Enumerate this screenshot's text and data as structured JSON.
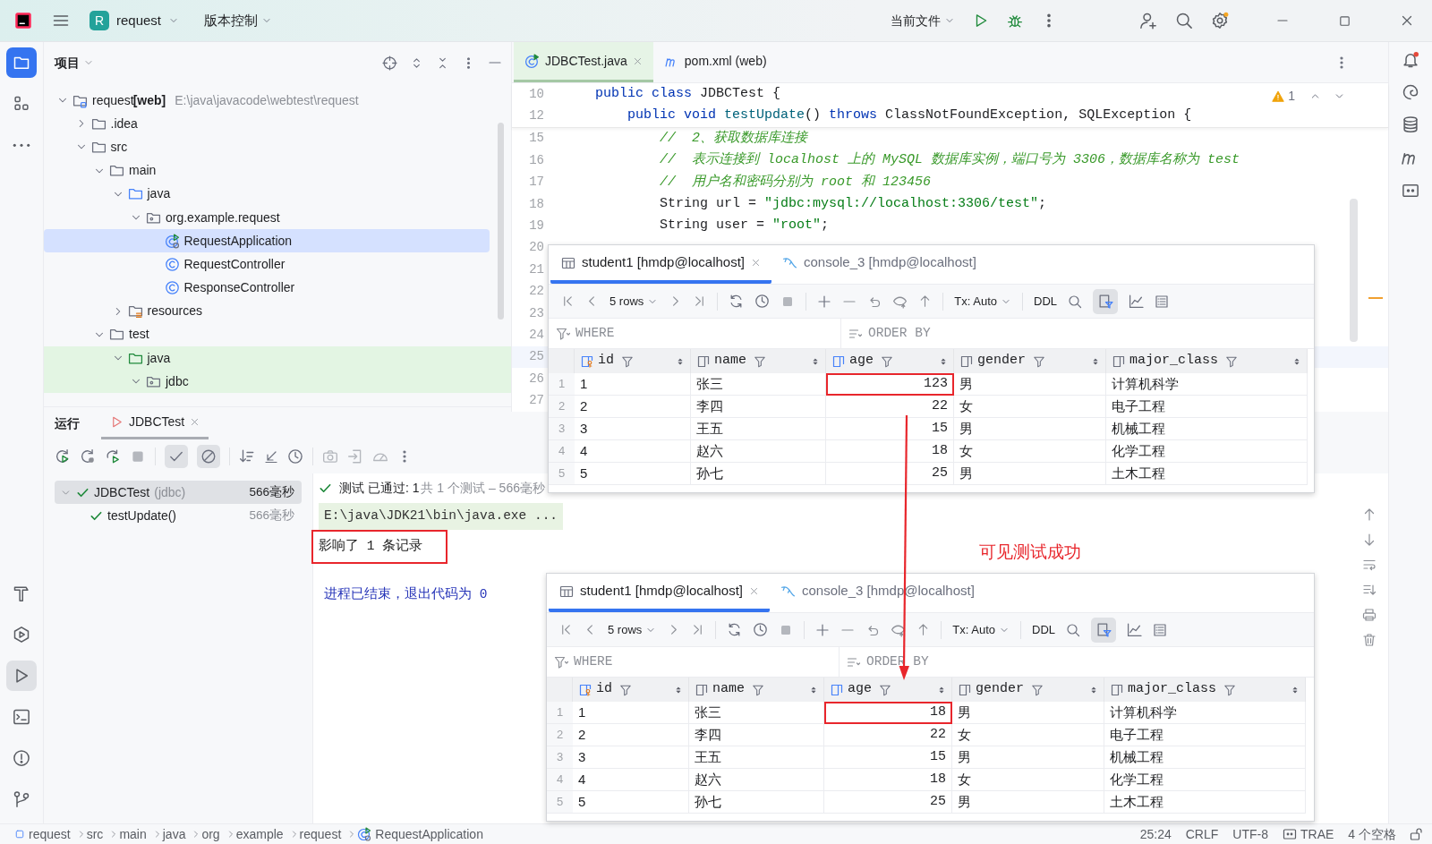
{
  "title_bar": {
    "project_badge": "R",
    "project": "request",
    "vcs": "版本控制",
    "run_config": "当前文件"
  },
  "left_tools": [
    {
      "kind": "project",
      "selected": true
    },
    {
      "kind": "structure",
      "selected": false
    },
    {
      "kind": "more",
      "selected": false
    },
    {
      "kind": "build",
      "selected": false
    },
    {
      "kind": "services",
      "selected": false
    },
    {
      "kind": "run",
      "selected": true
    },
    {
      "kind": "terminal",
      "selected": false
    },
    {
      "kind": "problems",
      "selected": false
    },
    {
      "kind": "git",
      "selected": false
    }
  ],
  "project_panel": {
    "title": "项目",
    "tree": [
      {
        "label": "request",
        "tag": "[web]",
        "path": "E:\\java\\javacode\\webtest\\request",
        "kind": "module",
        "expanded": true,
        "selected": false,
        "children": [
          {
            "label": ".idea",
            "kind": "folder",
            "expanded": false,
            "selected": false
          },
          {
            "label": "src",
            "kind": "folder",
            "expanded": true,
            "selected": false,
            "children": [
              {
                "label": "main",
                "kind": "folder",
                "expanded": true,
                "selected": false,
                "children": [
                  {
                    "label": "java",
                    "kind": "source",
                    "expanded": true,
                    "selected": false,
                    "children": [
                      {
                        "label": "org.example.request",
                        "kind": "package",
                        "expanded": true,
                        "selected": false,
                        "children": [
                          {
                            "label": "RequestApplication",
                            "kind": "app",
                            "selected": true
                          },
                          {
                            "label": "RequestController",
                            "kind": "class",
                            "selected": false
                          },
                          {
                            "label": "ResponseController",
                            "kind": "class",
                            "selected": false
                          }
                        ]
                      }
                    ]
                  },
                  {
                    "label": "resources",
                    "kind": "resources",
                    "expanded": false,
                    "selected": false
                  }
                ]
              },
              {
                "label": "test",
                "kind": "folder",
                "expanded": true,
                "selected": false,
                "children": [
                  {
                    "label": "java",
                    "kind": "test-source",
                    "expanded": true,
                    "selected": false,
                    "children": [
                      {
                        "label": "jdbc",
                        "kind": "package",
                        "expanded": true,
                        "selected": false
                      }
                    ]
                  }
                ]
              }
            ]
          }
        ]
      }
    ]
  },
  "editor": {
    "tabs": [
      {
        "label": "JDBCTest.java",
        "kind": "test-class",
        "selected": true,
        "closable": true
      },
      {
        "label": "pom.xml (web)",
        "kind": "maven",
        "selected": false,
        "closable": false
      }
    ],
    "warnings": "1",
    "sticky_lines": [
      {
        "number": "10",
        "tokens": [
          {
            "kind": "keyword",
            "text": "public class"
          },
          {
            "kind": "plain",
            "text": " JDBCTest {"
          }
        ]
      },
      {
        "number": "12",
        "tokens": [
          {
            "kind": "keyword",
            "text": "    public void"
          },
          {
            "kind": "method",
            "text": " testUpdate"
          },
          {
            "kind": "plain",
            "text": "() "
          },
          {
            "kind": "keyword",
            "text": "throws"
          },
          {
            "kind": "plain",
            "text": " ClassNotFoundException, SQLException {"
          }
        ]
      }
    ],
    "lines": [
      {
        "number": "15",
        "current": false,
        "tokens": [
          {
            "kind": "comment",
            "text": "        //  2、获取数据库连接"
          }
        ]
      },
      {
        "number": "16",
        "current": false,
        "tokens": [
          {
            "kind": "comment",
            "text": "        //  表示连接到 localhost 上的 MySQL 数据库实例，端口号为 3306，数据库名称为 test"
          }
        ]
      },
      {
        "number": "17",
        "current": false,
        "tokens": [
          {
            "kind": "comment",
            "text": "        //  用户名和密码分别为 root 和 123456"
          }
        ]
      },
      {
        "number": "18",
        "current": false,
        "tokens": [
          {
            "kind": "plain",
            "text": "        String url = "
          },
          {
            "kind": "string",
            "text": "\"jdbc:mysql://localhost:3306/test\""
          },
          {
            "kind": "plain",
            "text": ";"
          }
        ]
      },
      {
        "number": "19",
        "current": false,
        "tokens": [
          {
            "kind": "plain",
            "text": "        String user = "
          },
          {
            "kind": "string",
            "text": "\"root\""
          },
          {
            "kind": "plain",
            "text": ";"
          }
        ]
      },
      {
        "number": "20",
        "current": false
      },
      {
        "number": "21",
        "current": false
      },
      {
        "number": "22",
        "current": false
      },
      {
        "number": "23",
        "current": false
      },
      {
        "number": "24",
        "current": false
      },
      {
        "number": "25",
        "current": true
      },
      {
        "number": "26",
        "current": false
      },
      {
        "number": "27",
        "current": false
      }
    ]
  },
  "run_panel": {
    "title": "运行",
    "tabs": [
      {
        "label": "JDBCTest",
        "selected": true
      }
    ],
    "toggles": [
      {
        "kind": "passed",
        "on": true
      },
      {
        "kind": "ignored",
        "on": true
      }
    ],
    "tests": [
      {
        "label": "JDBCTest",
        "detail": "(jdbc)",
        "time": "566毫秒",
        "selected": true,
        "expanded": true,
        "children": [
          {
            "label": "testUpdate()",
            "time": "566毫秒",
            "selected": false
          }
        ]
      }
    ],
    "status": "测试 已通过: 1",
    "summary": "共 1 个测试 – 566毫秒",
    "console": [
      {
        "kind": "command",
        "text": "E:\\java\\JDK21\\bin\\java.exe ...",
        "highlighted": false
      },
      {
        "kind": "output",
        "text": "影响了 1 条记录",
        "highlighted": true
      },
      {
        "kind": "exit",
        "text": "进程已结束，退出代码为 0",
        "highlighted": false
      }
    ]
  },
  "db_grids": [
    {
      "tabs": [
        {
          "label": "student1 [hmdp@localhost]",
          "kind": "table",
          "selected": true
        },
        {
          "label": "console_3 [hmdp@localhost]",
          "kind": "console",
          "selected": false
        }
      ],
      "rows_label": "5 rows",
      "tx": "Tx: Auto",
      "ddl": "DDL",
      "filter_on": true,
      "where": "WHERE",
      "order_by": "ORDER BY",
      "columns": [
        {
          "name": "id",
          "kind": "key",
          "marked": false
        },
        {
          "name": "name",
          "kind": "text",
          "marked": false
        },
        {
          "name": "age",
          "kind": "number",
          "marked": true
        },
        {
          "name": "gender",
          "kind": "text",
          "marked": false
        },
        {
          "name": "major_class",
          "kind": "text",
          "marked": false
        }
      ],
      "rows": [
        {
          "number": "1",
          "cells": [
            "1",
            "张三",
            "123",
            "男",
            "计算机科学"
          ],
          "marked": true
        },
        {
          "number": "2",
          "cells": [
            "2",
            "李四",
            "22",
            "女",
            "电子工程"
          ],
          "marked": false
        },
        {
          "number": "3",
          "cells": [
            "3",
            "王五",
            "15",
            "男",
            "机械工程"
          ],
          "marked": false
        },
        {
          "number": "4",
          "cells": [
            "4",
            "赵六",
            "18",
            "女",
            "化学工程"
          ],
          "marked": false
        },
        {
          "number": "5",
          "cells": [
            "5",
            "孙七",
            "25",
            "男",
            "土木工程"
          ],
          "marked": false
        }
      ]
    },
    {
      "tabs": [
        {
          "label": "student1 [hmdp@localhost]",
          "kind": "table",
          "selected": true
        },
        {
          "label": "console_3 [hmdp@localhost]",
          "kind": "console",
          "selected": false
        }
      ],
      "rows_label": "5 rows",
      "tx": "Tx: Auto",
      "ddl": "DDL",
      "filter_on": true,
      "where": "WHERE",
      "order_by": "ORDER BY",
      "columns": [
        {
          "name": "id",
          "kind": "key",
          "marked": false
        },
        {
          "name": "name",
          "kind": "text",
          "marked": false
        },
        {
          "name": "age",
          "kind": "number",
          "marked": true
        },
        {
          "name": "gender",
          "kind": "text",
          "marked": false
        },
        {
          "name": "major_class",
          "kind": "text",
          "marked": false
        }
      ],
      "rows": [
        {
          "number": "1",
          "cells": [
            "1",
            "张三",
            "18",
            "男",
            "计算机科学"
          ],
          "marked": true
        },
        {
          "number": "2",
          "cells": [
            "2",
            "李四",
            "22",
            "女",
            "电子工程"
          ],
          "marked": false
        },
        {
          "number": "3",
          "cells": [
            "3",
            "王五",
            "15",
            "男",
            "机械工程"
          ],
          "marked": false
        },
        {
          "number": "4",
          "cells": [
            "4",
            "赵六",
            "18",
            "女",
            "化学工程"
          ],
          "marked": false
        },
        {
          "number": "5",
          "cells": [
            "5",
            "孙七",
            "25",
            "男",
            "土木工程"
          ],
          "marked": false
        }
      ]
    }
  ],
  "annotation": {
    "text": "可见测试成功"
  },
  "breadcrumb": [
    {
      "label": "request",
      "kind": "module"
    },
    {
      "label": "src",
      "kind": "plain"
    },
    {
      "label": "main",
      "kind": "plain"
    },
    {
      "label": "java",
      "kind": "plain"
    },
    {
      "label": "org",
      "kind": "plain"
    },
    {
      "label": "example",
      "kind": "plain"
    },
    {
      "label": "request",
      "kind": "plain"
    },
    {
      "label": "RequestApplication",
      "kind": "app"
    }
  ],
  "status_bar": {
    "position": "25:24",
    "line_separator": "CRLF",
    "encoding": "UTF-8",
    "plugin": "TRAE",
    "indent": "4 个空格"
  }
}
